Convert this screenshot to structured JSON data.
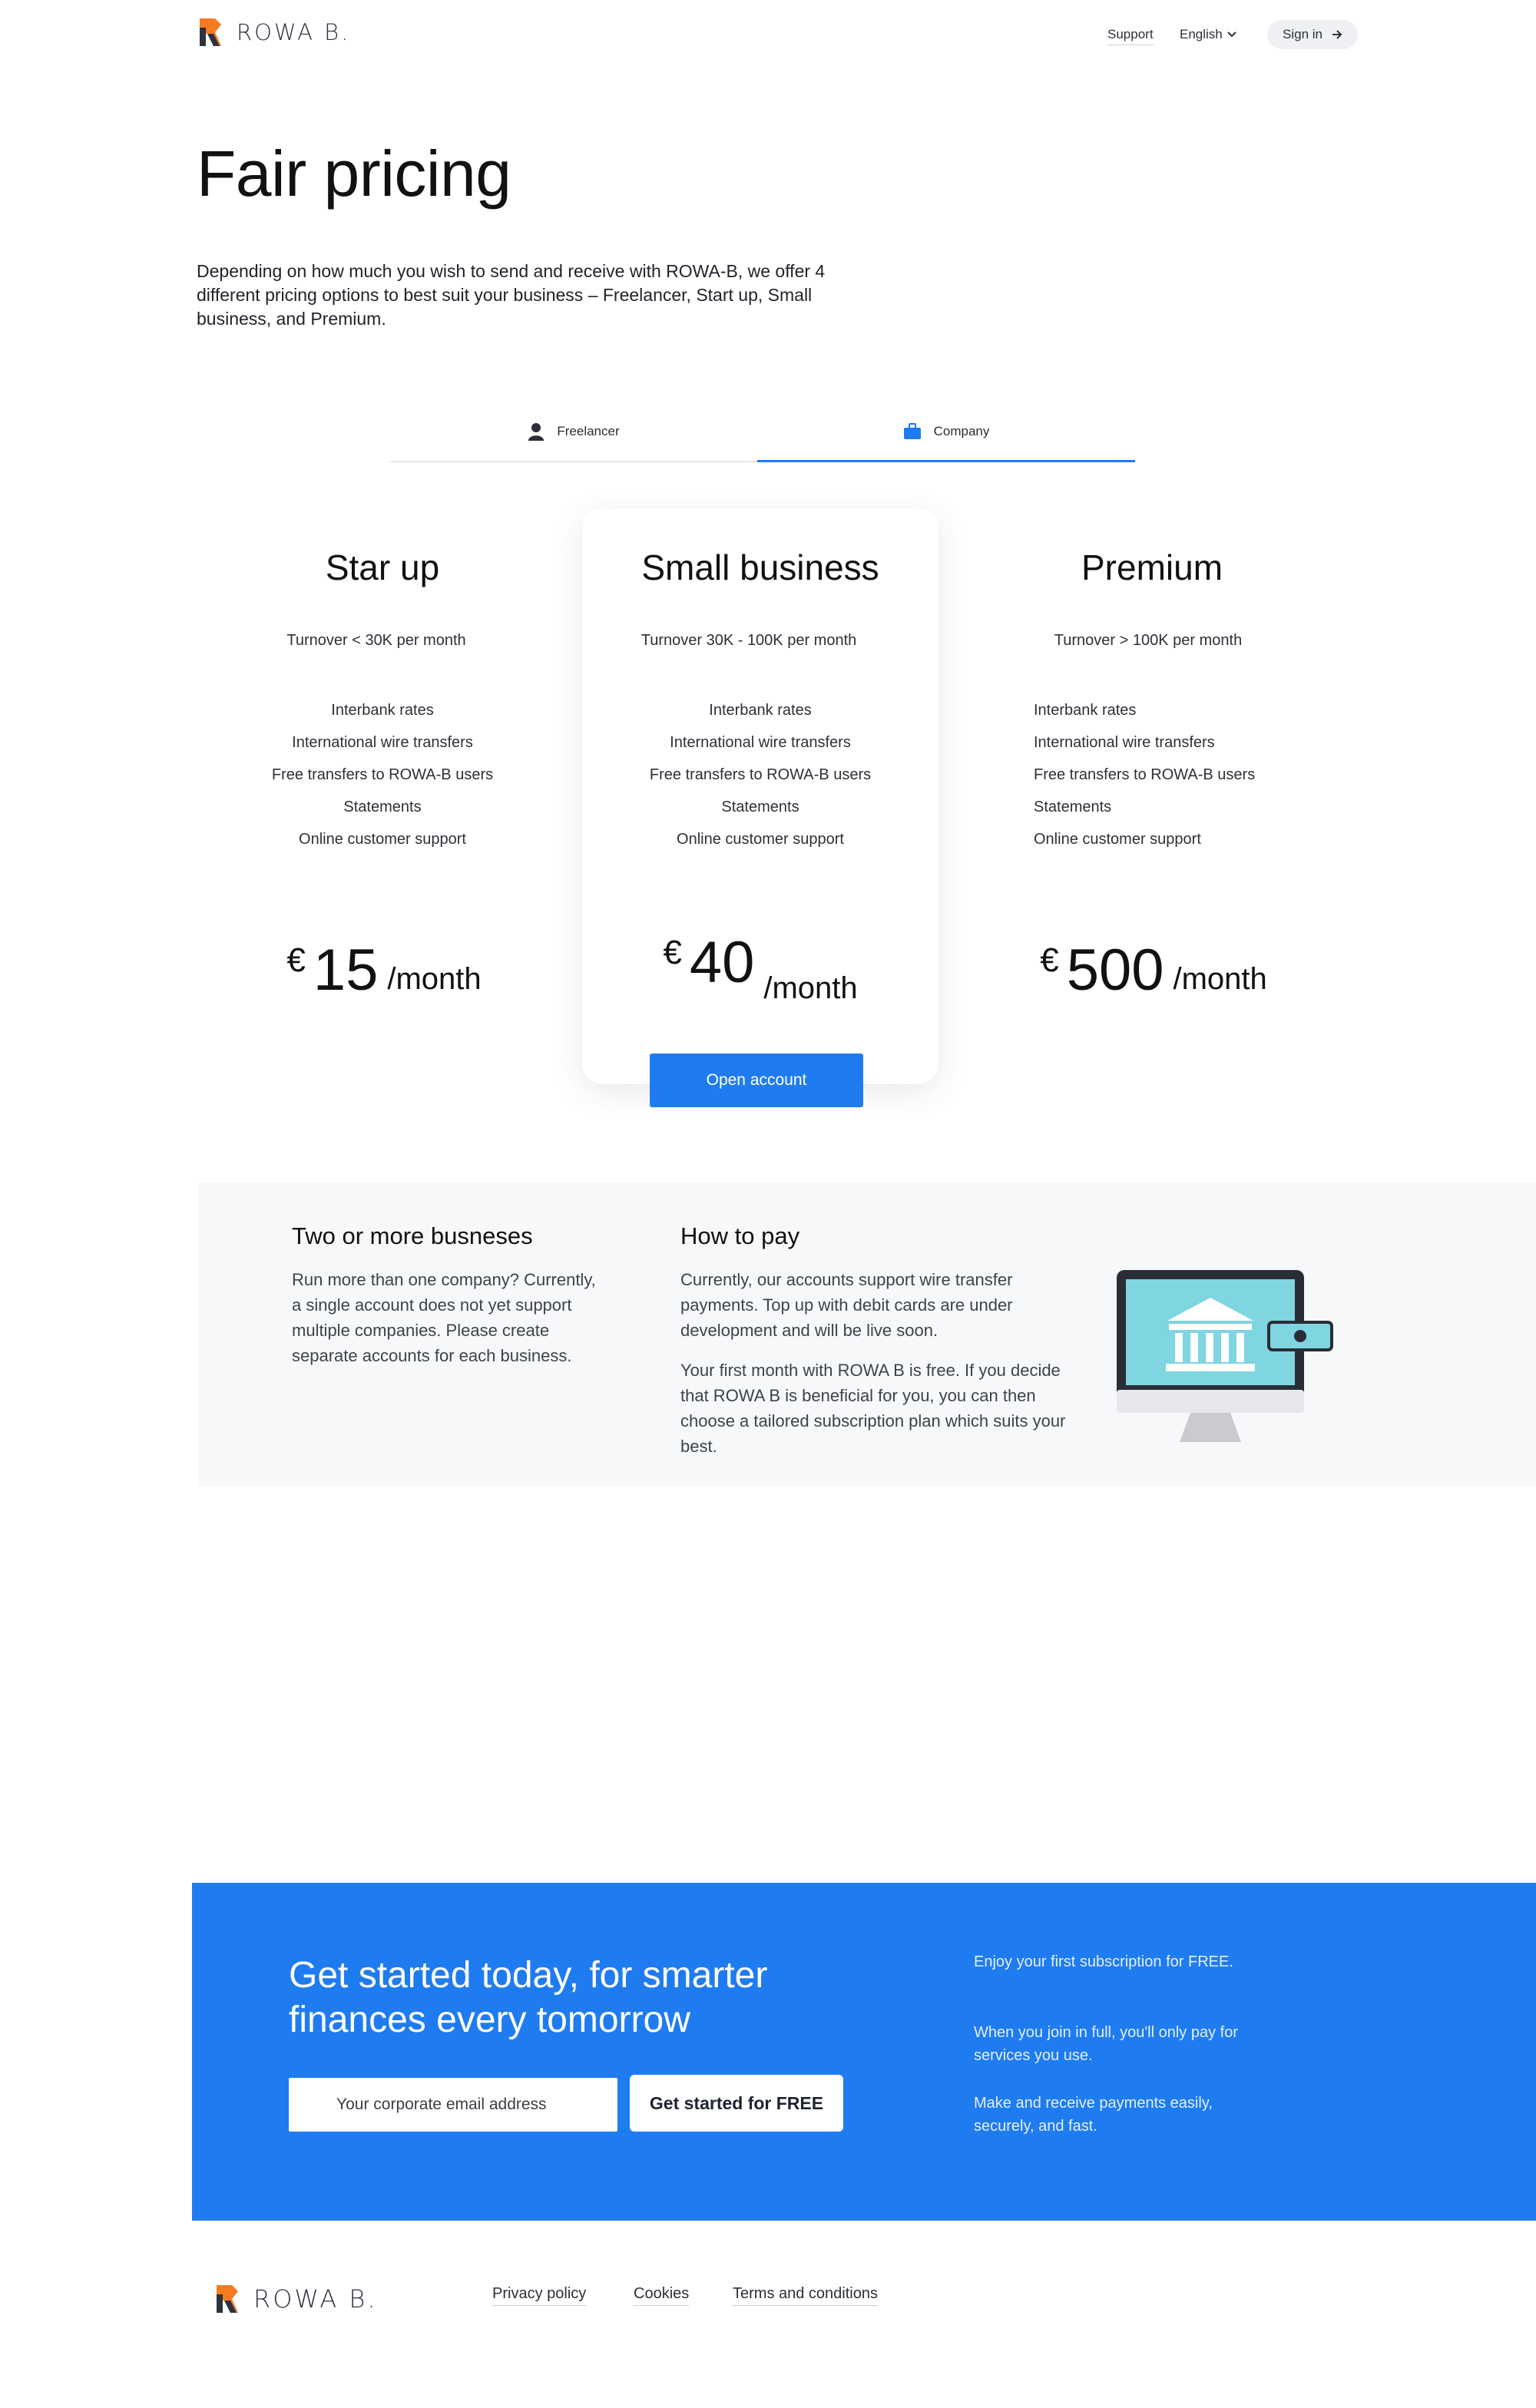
{
  "header": {
    "logo_text": "ROWA B.",
    "support": "Support",
    "language": "English",
    "sign_in": "Sign in"
  },
  "hero": {
    "title": "Fair pricing",
    "intro": "Depending on how much you wish to send and receive with ROWA-B, we offer 4 different pricing options to best suit your business – Freelancer, Start up, Small business, and Premium."
  },
  "tabs": {
    "items": [
      {
        "label": "Freelancer",
        "icon": "person-icon",
        "active": false
      },
      {
        "label": "Company",
        "icon": "briefcase-icon",
        "active": true
      }
    ],
    "accent": "#1f7cf0"
  },
  "plans": [
    {
      "name": "Star up",
      "turnover": "Turnover < 30K per month",
      "features": [
        "Interbank rates",
        "International wire transfers",
        "Free transfers to ROWA-B users",
        "Statements",
        "Online customer support"
      ],
      "currency": "€",
      "amount": "15",
      "period": "/month"
    },
    {
      "name": "Small business",
      "turnover": "Turnover 30K - 100K per month",
      "features": [
        "Interbank rates",
        "International wire transfers",
        "Free transfers to ROWA-B users",
        "Statements",
        "Online customer support"
      ],
      "currency": "€",
      "amount": "40",
      "period": "/month",
      "cta": "Open account"
    },
    {
      "name": "Premium",
      "turnover": "Turnover > 100K per month",
      "features": [
        "Interbank rates",
        "International wire transfers",
        "Free transfers to ROWA-B users",
        "Statements",
        "Online customer support"
      ],
      "currency": "€",
      "amount": "500",
      "period": "/month"
    }
  ],
  "info": {
    "multi": {
      "title": "Two or more busneses",
      "text": "Run more than one company? Currently, a single account does not yet support multiple companies. Please create separate accounts for each business."
    },
    "pay": {
      "title": "How to pay",
      "text1": "Currently, our accounts support wire transfer payments. Top up with debit cards are under development and will be live soon.",
      "text2": "Your first month with ROWA B is free. If you decide that ROWA B is beneficial for you, you can then choose a tailored subscription plan which suits your best."
    },
    "illustration": "bank-monitor-icon"
  },
  "cta": {
    "title": "Get started today, for smarter finances every tomorrow",
    "email_placeholder": "Your corporate email address",
    "button": "Get started for FREE",
    "notes": [
      "Enjoy your first subscription for FREE.",
      "When you join in full, you'll only pay for services you use.",
      "Make and receive payments easily, securely, and fast."
    ],
    "color": "#1f7cf0"
  },
  "footer": {
    "logo_text": "ROWA B.",
    "links": [
      "Privacy policy",
      "Cookies",
      "Terms and conditions"
    ]
  }
}
